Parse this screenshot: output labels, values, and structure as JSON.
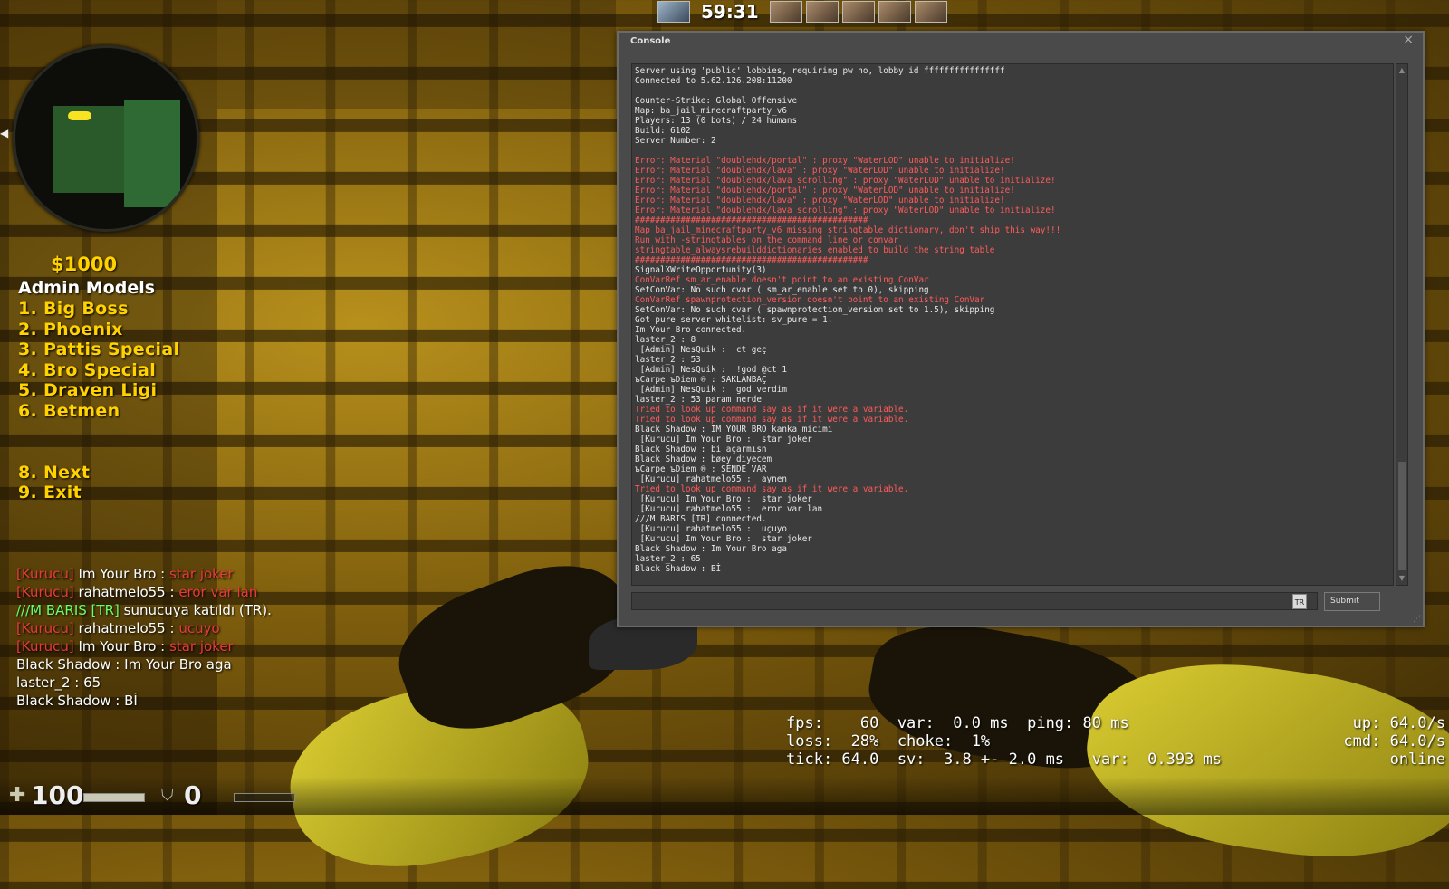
{
  "hud": {
    "timer": "59:31",
    "money": "$1000",
    "health": "100",
    "health_fraction": 1.0,
    "armor": "0",
    "armor_fraction": 0.0
  },
  "admin_menu": {
    "title": "Admin Models",
    "items": [
      "1. Big Boss",
      "2. Phoenix",
      "3. Pattis Special",
      "4. Bro Special",
      "5. Draven Ligi",
      "6. Betmen"
    ],
    "nav": [
      "8. Next",
      "9. Exit"
    ]
  },
  "chat": [
    {
      "tag": "[Kurucu]",
      "name": " Im Your Bro : ",
      "text": "star joker",
      "style": "tag"
    },
    {
      "tag": "[Kurucu]",
      "name": " rahatmelo55 : ",
      "text": " eror var lan",
      "style": "tag"
    },
    {
      "tag": "",
      "name": "///M BARIS [TR]",
      "text": " sunucuya katıldı (TR).",
      "style": "join"
    },
    {
      "tag": "[Kurucu]",
      "name": " rahatmelo55 : ",
      "text": " ucuyo",
      "style": "tag"
    },
    {
      "tag": "[Kurucu]",
      "name": " Im Your Bro : ",
      "text": " star joker",
      "style": "tag"
    },
    {
      "tag": "",
      "name": "Black Shadow : ",
      "text": "Im Your Bro aga",
      "style": "plain"
    },
    {
      "tag": "",
      "name": "laster_2 : ",
      "text": "65",
      "style": "plain"
    },
    {
      "tag": "",
      "name": "Black Shadow : ",
      "text": "Bİ",
      "style": "plain"
    }
  ],
  "console": {
    "title": "Console",
    "close": "×",
    "submit_label": "Submit",
    "lang_badge": "TR",
    "input_value": "",
    "lines": [
      {
        "t": "Server using 'public' lobbies, requiring pw no, lobby id ffffffffffffffff",
        "e": false
      },
      {
        "t": "Connected to 5.62.126.208:11200",
        "e": false
      },
      {
        "t": "",
        "e": false
      },
      {
        "t": "Counter-Strike: Global Offensive",
        "e": false
      },
      {
        "t": "Map: ba_jail_minecraftparty_v6",
        "e": false
      },
      {
        "t": "Players: 13 (0 bots) / 24 humans",
        "e": false
      },
      {
        "t": "Build: 6102",
        "e": false
      },
      {
        "t": "Server Number: 2",
        "e": false
      },
      {
        "t": "",
        "e": false
      },
      {
        "t": "Error: Material \"doublehdx/portal\" : proxy \"WaterLOD\" unable to initialize!",
        "e": true
      },
      {
        "t": "Error: Material \"doublehdx/lava\" : proxy \"WaterLOD\" unable to initialize!",
        "e": true
      },
      {
        "t": "Error: Material \"doublehdx/lava scrolling\" : proxy \"WaterLOD\" unable to initialize!",
        "e": true
      },
      {
        "t": "Error: Material \"doublehdx/portal\" : proxy \"WaterLOD\" unable to initialize!",
        "e": true
      },
      {
        "t": "Error: Material \"doublehdx/lava\" : proxy \"WaterLOD\" unable to initialize!",
        "e": true
      },
      {
        "t": "Error: Material \"doublehdx/lava scrolling\" : proxy \"WaterLOD\" unable to initialize!",
        "e": true
      },
      {
        "t": "##############################################",
        "e": true
      },
      {
        "t": "Map ba_jail_minecraftparty_v6 missing stringtable dictionary, don't ship this way!!!",
        "e": true
      },
      {
        "t": "Run with -stringtables on the command line or convar",
        "e": true
      },
      {
        "t": "stringtable_alwaysrebuilddictionaries enabled to build the string table",
        "e": true
      },
      {
        "t": "##############################################",
        "e": true
      },
      {
        "t": "SignalXWriteOpportunity(3)",
        "e": false
      },
      {
        "t": "ConVarRef sm_ar_enable doesn't point to an existing ConVar",
        "e": true
      },
      {
        "t": "SetConVar: No such cvar ( sm_ar_enable set to 0), skipping",
        "e": false
      },
      {
        "t": "ConVarRef spawnprotection_version doesn't point to an existing ConVar",
        "e": true
      },
      {
        "t": "SetConVar: No such cvar ( spawnprotection_version set to 1.5), skipping",
        "e": false
      },
      {
        "t": "Got pure server whitelist: sv_pure = 1.",
        "e": false
      },
      {
        "t": "Im Your Bro connected.",
        "e": false
      },
      {
        "t": "laster_2 : 8",
        "e": false
      },
      {
        "t": " [Admin] NesQuik :  ct geç",
        "e": false
      },
      {
        "t": "laster_2 : 53",
        "e": false
      },
      {
        "t": " [Admin] NesQuik :  !god @ct 1",
        "e": false
      },
      {
        "t": "ъCarpe ъDiem ® : SAKLANBAÇ",
        "e": false
      },
      {
        "t": " [Admin] NesQuik :  god verdim",
        "e": false
      },
      {
        "t": "laster_2 : 53 param nerde",
        "e": false
      },
      {
        "t": "Tried to look up command say as if it were a variable.",
        "e": true
      },
      {
        "t": "Tried to look up command say as if it were a variable.",
        "e": true
      },
      {
        "t": "Black Shadow : IM YOUR BRO kanka micimi",
        "e": false
      },
      {
        "t": " [Kurucu] Im Your Bro :  star joker",
        "e": false
      },
      {
        "t": "Black Shadow : bi açarmısn",
        "e": false
      },
      {
        "t": "Black Shadow : bøey diyecem",
        "e": false
      },
      {
        "t": "ъCarpe ъDiem ® : SENDE VAR",
        "e": false
      },
      {
        "t": " [Kurucu] rahatmelo55 :  aynen",
        "e": false
      },
      {
        "t": "Tried to look up command say as if it were a variable.",
        "e": true
      },
      {
        "t": " [Kurucu] Im Your Bro :  star joker",
        "e": false
      },
      {
        "t": " [Kurucu] rahatmelo55 :  eror var lan",
        "e": false
      },
      {
        "t": "///M BARIS [TR] connected.",
        "e": false
      },
      {
        "t": " [Kurucu] rahatmelo55 :  uçuyo",
        "e": false
      },
      {
        "t": " [Kurucu] Im Your Bro :  star joker",
        "e": false
      },
      {
        "t": "Black Shadow : Im Your Bro aga",
        "e": false
      },
      {
        "t": "laster_2 : 65",
        "e": false
      },
      {
        "t": "Black Shadow : Bİ",
        "e": false
      }
    ]
  },
  "netgraph": {
    "left": "fps:    60  var:  0.0 ms  ping: 80 ms\nloss:  28%  choke:  1%\ntick: 64.0  sv:  3.8 +- 2.0 ms   var:  0.393 ms",
    "right": "up: 64.0/s\ncmd: 64.0/s\nonline"
  },
  "colors": {
    "money": "#ffd200",
    "menu_item": "#ffd200",
    "chat_tag": "#e83a3a",
    "chat_join": "#66ff66",
    "console_error": "#ff5b5b",
    "console_bg": "#3c3c3c"
  },
  "icons": {
    "health": "plus-icon",
    "armor": "shield-icon"
  }
}
